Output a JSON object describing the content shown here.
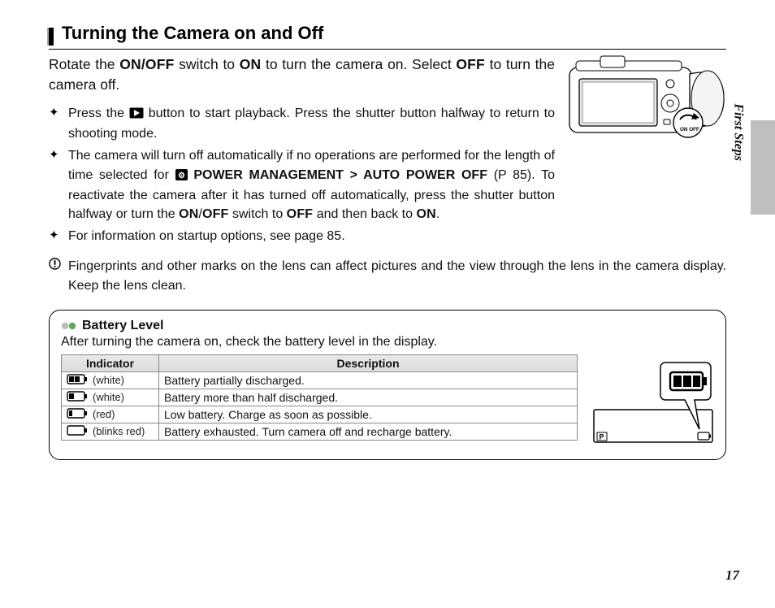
{
  "section_label": "First Steps",
  "page_number": "17",
  "heading": "Turning the Camera on and Off",
  "intro": {
    "pre1": "Rotate the ",
    "onoff1": "ON/OFF",
    "mid1": " switch to ",
    "on1": "ON",
    "mid2": " to turn the camera on.  Select ",
    "off1": "OFF",
    "post1": " to turn the camera off."
  },
  "onoff_label": "ON OFF",
  "bullets": [
    {
      "pre": "Press the ",
      "post": " button to start playback.  Press the shutter button halfway to return to shooting mode."
    },
    {
      "pre": "The camera will turn off automatically if no operations are performed for the length of time selected for ",
      "menu": " POWER MANAGEMENT > AUTO POWER OFF",
      "ref": " (P 85).  To reactivate the camera after it has turned off automatically, press the shutter button halfway or turn the ",
      "onoff": "ON",
      "slash": "/",
      "off": "OFF",
      "mid": " switch to ",
      "off2": "OFF",
      "mid2": " and then back to ",
      "on2": "ON",
      "end": "."
    },
    {
      "text": "For information on startup options, see page 85."
    }
  ],
  "caution": "Fingerprints and other marks on the lens can affect pictures and the view through the lens in the camera display. Keep the lens clean.",
  "battery": {
    "title": "Battery Level",
    "sub": "After turning the camera on, check the battery level in the display.",
    "headers": {
      "indicator": "Indicator",
      "description": "Description"
    },
    "rows": [
      {
        "label": "(white)",
        "fill": "partial-white",
        "desc": "Battery partially discharged."
      },
      {
        "label": "(white)",
        "fill": "half-white",
        "desc": "Battery more than half discharged."
      },
      {
        "label": "(red)",
        "fill": "low-red",
        "desc": "Low battery.  Charge as soon as possible."
      },
      {
        "label": "(blinks red)",
        "fill": "empty",
        "desc": "Battery exhausted.  Turn camera off and recharge battery."
      }
    ]
  },
  "display_mode_label": "P"
}
